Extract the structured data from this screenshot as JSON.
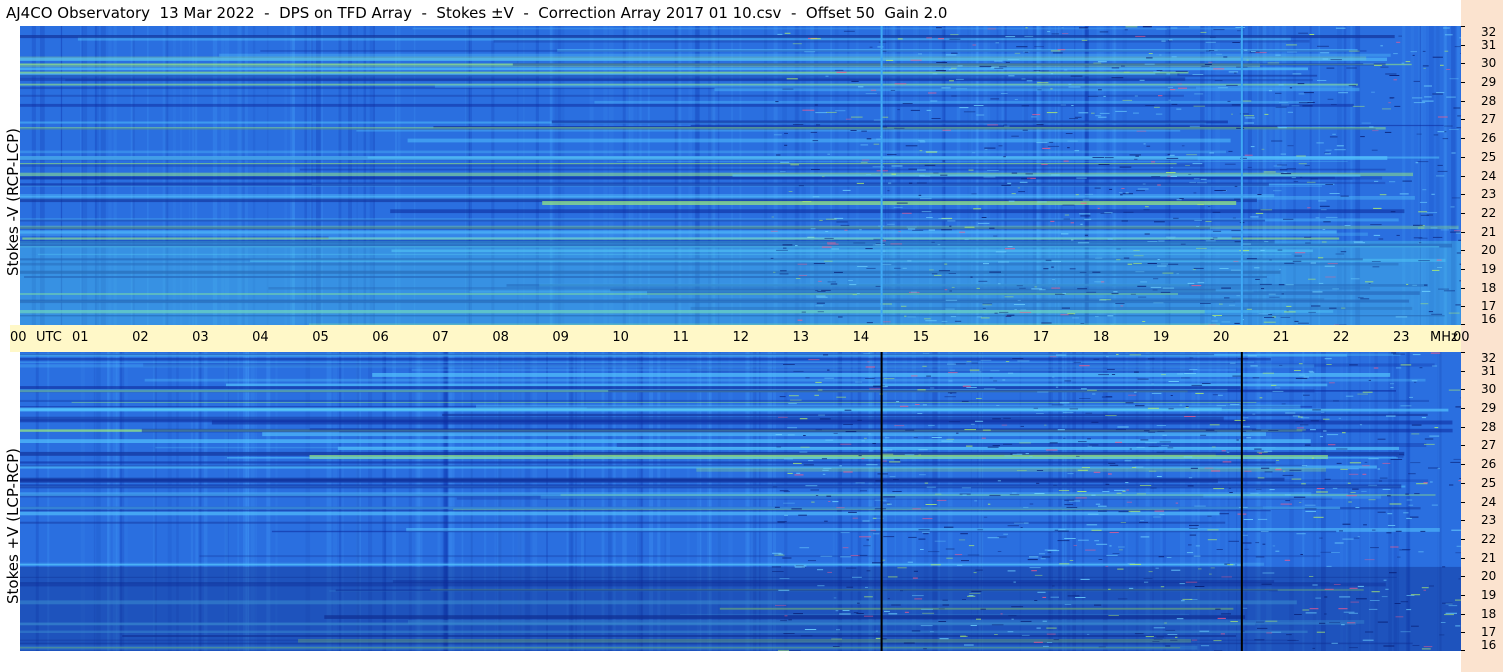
{
  "title": "AJ4CO Observatory  13 Mar 2022  -  DPS on TFD Array  -  Stokes ±V  -  Correction Array 2017 01 10.csv  -  Offset 50  Gain 2.0",
  "chart_data": [
    {
      "type": "heatmap",
      "panel": "top",
      "ylabel": "Stokes -V (RCP-LCP)",
      "y_unit": "MHz",
      "y_ticks": [
        16,
        17,
        18,
        19,
        20,
        21,
        22,
        23,
        24,
        25,
        26,
        27,
        28,
        29,
        30,
        31,
        32
      ],
      "ylim": [
        16,
        32
      ],
      "x_ticks": [
        "00",
        "01",
        "02",
        "03",
        "04",
        "05",
        "06",
        "07",
        "08",
        "09",
        "10",
        "11",
        "12",
        "13",
        "14",
        "15",
        "16",
        "17",
        "18",
        "19",
        "20",
        "21",
        "22",
        "23",
        "00"
      ],
      "x_unit": "UTC",
      "xlim_hours": [
        0,
        24
      ],
      "marker_hours": [
        14.35,
        20.35
      ],
      "marker_color": "#3fa9f5"
    },
    {
      "type": "heatmap",
      "panel": "bottom",
      "ylabel": "Stokes +V  (LCP-RCP)",
      "y_unit": "MHz",
      "y_ticks": [
        16,
        17,
        18,
        19,
        20,
        21,
        22,
        23,
        24,
        25,
        26,
        27,
        28,
        29,
        30,
        31,
        32
      ],
      "ylim": [
        16,
        32
      ],
      "x_ticks": [
        "00",
        "01",
        "02",
        "03",
        "04",
        "05",
        "06",
        "07",
        "08",
        "09",
        "10",
        "11",
        "12",
        "13",
        "14",
        "15",
        "16",
        "17",
        "18",
        "19",
        "20",
        "21",
        "22",
        "23",
        "00"
      ],
      "x_unit": "UTC",
      "xlim_hours": [
        0,
        24
      ],
      "marker_hours": [
        14.35,
        20.35
      ],
      "marker_color": "#000000"
    }
  ],
  "colors": {
    "background": "#2a6fe0",
    "axis_band": "#fff8c8",
    "right_band": "#fbe3cf"
  }
}
